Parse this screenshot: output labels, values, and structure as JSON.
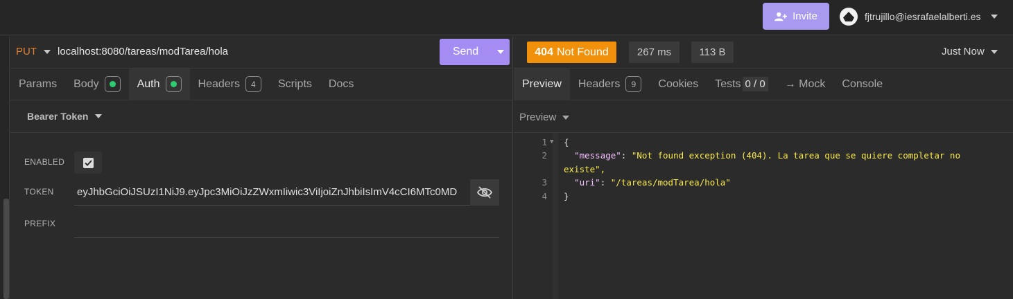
{
  "topbar": {
    "invite_label": "Invite",
    "account_email": "fjtrujillo@iesrafaelalberti.es"
  },
  "request": {
    "method": "PUT",
    "url": "localhost:8080/tareas/modTarea/hola",
    "send_label": "Send",
    "tabs": [
      {
        "label": "Params"
      },
      {
        "label": "Body"
      },
      {
        "label": "Auth"
      },
      {
        "label": "Headers",
        "count": "4"
      },
      {
        "label": "Scripts"
      },
      {
        "label": "Docs"
      }
    ],
    "auth_type": "Bearer Token",
    "enabled_label": "ENABLED",
    "enabled": true,
    "token_label": "TOKEN",
    "token_value": "eyJhbGciOiJSUzI1NiJ9.eyJpc3MiOiJzZWxmIiwic3ViIjoiZnJhbiIsImV4cCI6MTc0MD",
    "prefix_label": "PREFIX",
    "prefix_value": ""
  },
  "response": {
    "status_code": "404",
    "status_text": "Not Found",
    "time": "267 ms",
    "size": "113 B",
    "timestamp_label": "Just Now",
    "tabs": [
      {
        "label": "Preview"
      },
      {
        "label": "Headers",
        "count": "9"
      },
      {
        "label": "Cookies"
      },
      {
        "label": "Tests",
        "count": "0 / 0"
      },
      {
        "label": "→ Mock"
      },
      {
        "label": "Console"
      }
    ],
    "preview_mode": "Preview",
    "body_lines": [
      {
        "n": "1",
        "text": "{"
      },
      {
        "n": "2",
        "key": "\"message\"",
        "value": "\"Not found exception (404). La tarea que se quiere completar no"
      },
      {
        "n": "",
        "value": "existe\","
      },
      {
        "n": "3",
        "key": "\"uri\"",
        "value": "\"/tareas/modTarea/hola\""
      },
      {
        "n": "4",
        "text": "}"
      }
    ]
  },
  "colors": {
    "accent": "#a58cf2",
    "method": "#e3812f",
    "status_error": "#f0900b",
    "success_dot": "#2ecc71"
  }
}
